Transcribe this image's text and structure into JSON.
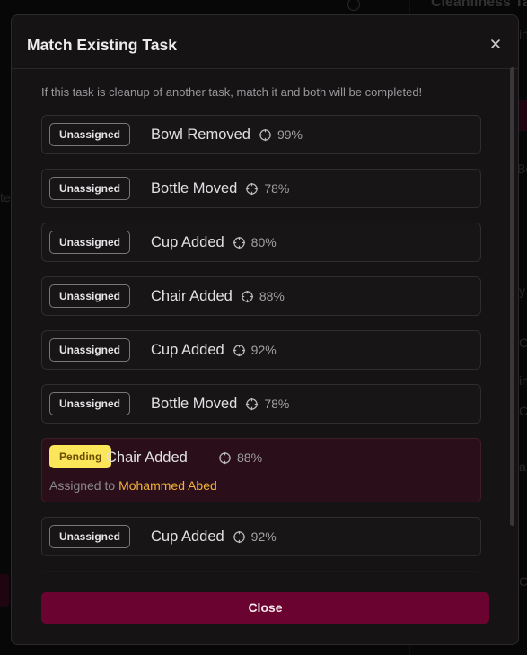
{
  "background": {
    "right_panel_title": "Cleanliness Ta",
    "fragments": [
      "Al",
      "Bo",
      "C",
      "C",
      "a",
      "C",
      "in",
      "in",
      "te",
      "y"
    ]
  },
  "modal": {
    "title": "Match Existing Task",
    "intro": "If this task is cleanup of another task, match it and both will be completed!",
    "close_button_label": "Close"
  },
  "tasks": [
    {
      "status": "Unassigned",
      "name": "Bowl Removed",
      "confidence": "99%"
    },
    {
      "status": "Unassigned",
      "name": "Bottle Moved",
      "confidence": "78%"
    },
    {
      "status": "Unassigned",
      "name": "Cup Added",
      "confidence": "80%"
    },
    {
      "status": "Unassigned",
      "name": "Chair Added",
      "confidence": "88%"
    },
    {
      "status": "Unassigned",
      "name": "Cup Added",
      "confidence": "92%"
    },
    {
      "status": "Unassigned",
      "name": "Bottle Moved",
      "confidence": "78%"
    },
    {
      "status": "Pending",
      "name": "Chair Added",
      "confidence": "88%",
      "assigned_prefix": "Assigned to",
      "assignee": "Mohammed Abed"
    },
    {
      "status": "Unassigned",
      "name": "Cup Added",
      "confidence": "92%"
    }
  ],
  "colors": {
    "accent": "#6a0330",
    "pending_badge": "#fbe65a",
    "assignee": "#f3b23a",
    "pending_card_bg": "#2a0f1b"
  },
  "icons": {
    "confidence": "crosshair-icon",
    "close": "close-icon"
  }
}
